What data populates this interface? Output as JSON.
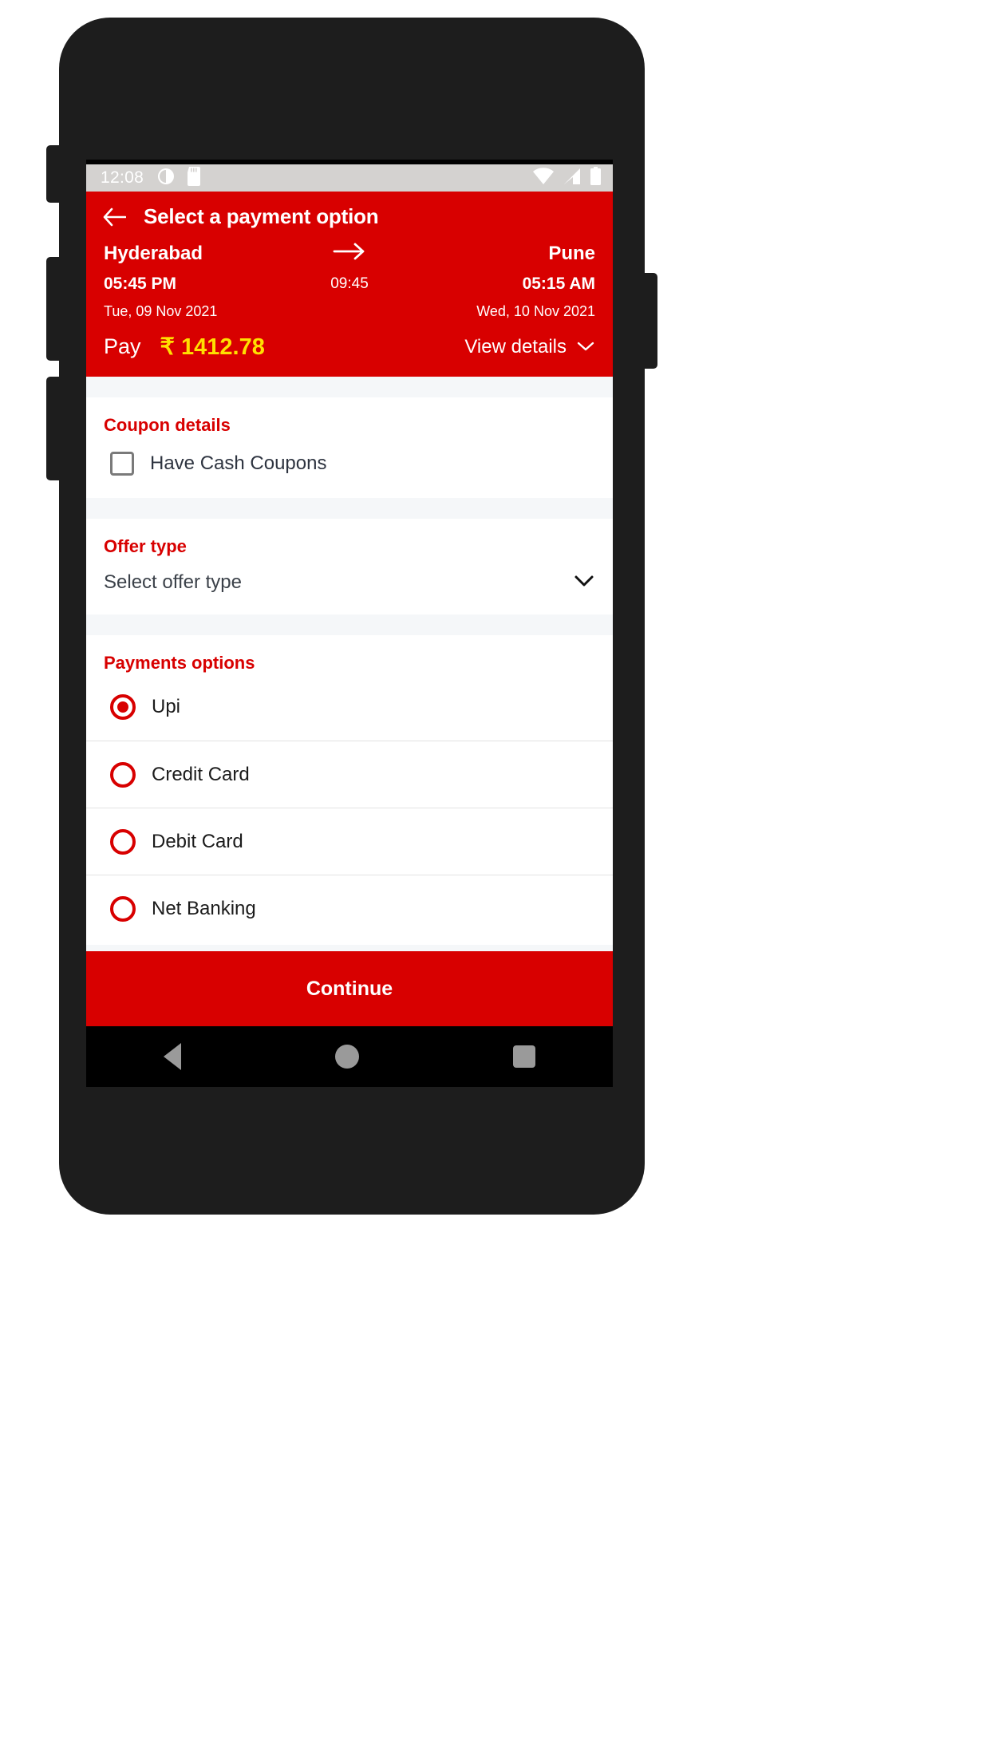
{
  "status_bar": {
    "time": "12:08",
    "left_icons": [
      "clock-icon",
      "sd-card-icon"
    ],
    "right_icons": [
      "wifi-icon",
      "cellular-signal-icon",
      "battery-icon"
    ]
  },
  "app_bar": {
    "back_icon": "back-arrow-icon",
    "title": "Select a payment option"
  },
  "journey": {
    "origin_city": "Hyderabad",
    "origin_time": "05:45 PM",
    "origin_date": "Tue, 09 Nov 2021",
    "duration": "09:45",
    "arrow_icon": "arrow-right-icon",
    "destination_city": "Pune",
    "destination_time": "05:15 AM",
    "destination_date": "Wed, 10 Nov 2021"
  },
  "pay_bar": {
    "label": "Pay",
    "amount": "₹ 1412.78",
    "view_details": "View details",
    "caret_icon": "chevron-down-icon"
  },
  "coupon": {
    "title": "Coupon details",
    "checkbox_label": "Have Cash Coupons",
    "checked": false
  },
  "offer": {
    "title": "Offer type",
    "selected_value": "Select offer type",
    "caret_icon": "chevron-down-icon"
  },
  "payments": {
    "title": "Payments options",
    "options": [
      {
        "label": "Upi",
        "selected": true
      },
      {
        "label": "Credit Card",
        "selected": false
      },
      {
        "label": "Debit Card",
        "selected": false
      },
      {
        "label": "Net Banking",
        "selected": false
      }
    ]
  },
  "footer": {
    "continue_label": "Continue"
  },
  "nav_bar": {
    "back_icon": "nav-back-icon",
    "home_icon": "nav-home-icon",
    "recents_icon": "nav-recents-icon"
  },
  "colors": {
    "brand_red": "#d80000",
    "amount_yellow": "#ffe000",
    "status_bar_grey": "#d4d2d0",
    "page_background": "#f5f7f9"
  }
}
